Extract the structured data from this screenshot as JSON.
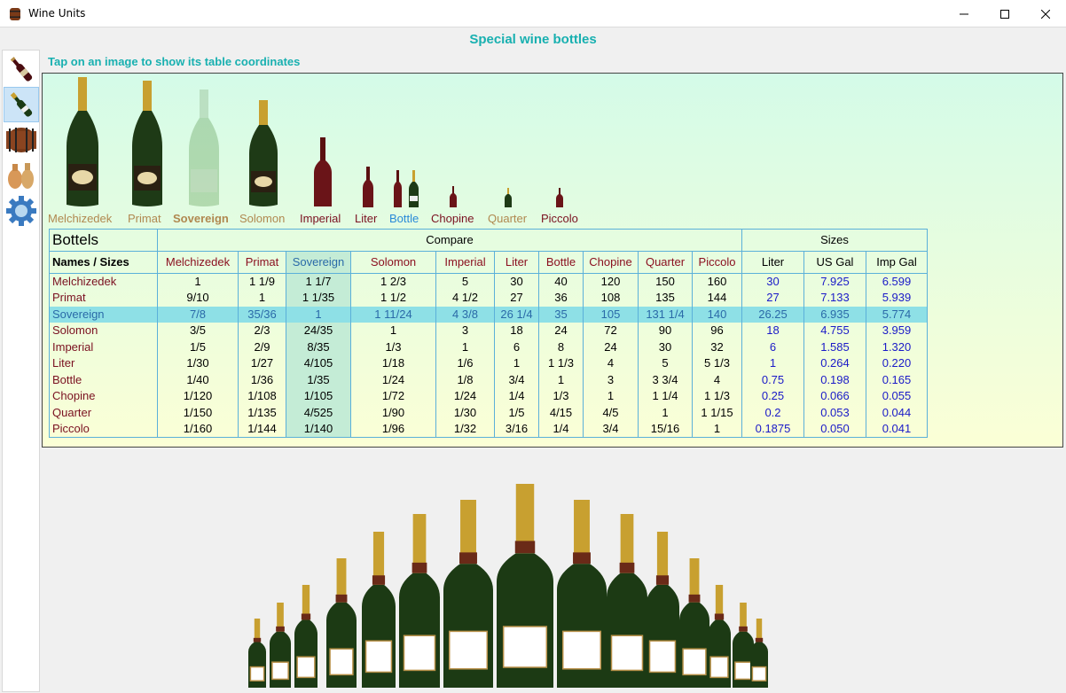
{
  "window": {
    "title": "Wine Units"
  },
  "page": {
    "title": "Special wine bottles",
    "hint": "Tap on an image to show its table coordinates"
  },
  "sidebar": [
    {
      "name": "red-wine-bottle-icon"
    },
    {
      "name": "champagne-bottle-icon",
      "selected": true
    },
    {
      "name": "wine-barrel-icon"
    },
    {
      "name": "amphora-icon"
    },
    {
      "name": "settings-gear-icon"
    }
  ],
  "bottles": [
    {
      "label": "Melchizedek",
      "color": "#b08850"
    },
    {
      "label": "Primat",
      "color": "#b08850"
    },
    {
      "label": "Sovereign",
      "color": "#b08850",
      "selected": true
    },
    {
      "label": "Solomon",
      "color": "#b08850"
    },
    {
      "label": "Imperial",
      "color": "#7a1020"
    },
    {
      "label": "Liter",
      "color": "#7a1020"
    },
    {
      "label": "Bottle",
      "color": "#2a8ad8"
    },
    {
      "label": "Chopine",
      "color": "#7a1020"
    },
    {
      "label": "Quarter",
      "color": "#b08850"
    },
    {
      "label": "Piccolo",
      "color": "#7a1020"
    }
  ],
  "table": {
    "caption": "Bottels",
    "compare_label": "Compare",
    "sizes_label": "Sizes",
    "corner_label": "Names / Sizes",
    "columns": [
      "Melchizedek",
      "Primat",
      "Sovereign",
      "Solomon",
      "Imperial",
      "Liter",
      "Bottle",
      "Chopine",
      "Quarter",
      "Piccolo"
    ],
    "size_columns": [
      "Liter",
      "US Gal",
      "Imp Gal"
    ],
    "rows": [
      {
        "name": "Melchizedek",
        "values": [
          "1",
          "1 1/9",
          "1 1/7",
          "1 2/3",
          "5",
          "30",
          "40",
          "120",
          "150",
          "160"
        ],
        "sizes": [
          "30",
          "7.925",
          "6.599"
        ]
      },
      {
        "name": "Primat",
        "values": [
          "9/10",
          "1",
          "1 1/35",
          "1 1/2",
          "4 1/2",
          "27",
          "36",
          "108",
          "135",
          "144"
        ],
        "sizes": [
          "27",
          "7.133",
          "5.939"
        ]
      },
      {
        "name": "Sovereign",
        "values": [
          "7/8",
          "35/36",
          "1",
          "1 11/24",
          "4 3/8",
          "26 1/4",
          "35",
          "105",
          "131 1/4",
          "140"
        ],
        "sizes": [
          "26.25",
          "6.935",
          "5.774"
        ]
      },
      {
        "name": "Solomon",
        "values": [
          "3/5",
          "2/3",
          "24/35",
          "1",
          "3",
          "18",
          "24",
          "72",
          "90",
          "96"
        ],
        "sizes": [
          "18",
          "4.755",
          "3.959"
        ]
      },
      {
        "name": "Imperial",
        "values": [
          "1/5",
          "2/9",
          "8/35",
          "1/3",
          "1",
          "6",
          "8",
          "24",
          "30",
          "32"
        ],
        "sizes": [
          "6",
          "1.585",
          "1.320"
        ]
      },
      {
        "name": "Liter",
        "values": [
          "1/30",
          "1/27",
          "4/105",
          "1/18",
          "1/6",
          "1",
          "1 1/3",
          "4",
          "5",
          "5 1/3"
        ],
        "sizes": [
          "1",
          "0.264",
          "0.220"
        ]
      },
      {
        "name": "Bottle",
        "values": [
          "1/40",
          "1/36",
          "1/35",
          "1/24",
          "1/8",
          "3/4",
          "1",
          "3",
          "3 3/4",
          "4"
        ],
        "sizes": [
          "0.75",
          "0.198",
          "0.165"
        ]
      },
      {
        "name": "Chopine",
        "values": [
          "1/120",
          "1/108",
          "1/105",
          "1/72",
          "1/24",
          "1/4",
          "1/3",
          "1",
          "1 1/4",
          "1 1/3"
        ],
        "sizes": [
          "0.25",
          "0.066",
          "0.055"
        ]
      },
      {
        "name": "Quarter",
        "values": [
          "1/150",
          "1/135",
          "4/525",
          "1/90",
          "1/30",
          "1/5",
          "4/15",
          "4/5",
          "1",
          "1 1/15"
        ],
        "sizes": [
          "0.2",
          "0.053",
          "0.044"
        ]
      },
      {
        "name": "Piccolo",
        "values": [
          "1/160",
          "1/144",
          "1/140",
          "1/96",
          "1/32",
          "3/16",
          "1/4",
          "3/4",
          "15/16",
          "1"
        ],
        "sizes": [
          "0.1875",
          "0.050",
          "0.041"
        ]
      }
    ]
  }
}
